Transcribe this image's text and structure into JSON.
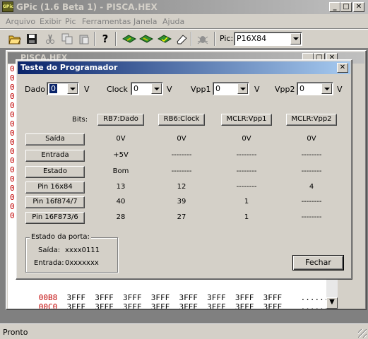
{
  "app": {
    "title": "GPic (1.6 Beta 1) - PISCA.HEX",
    "icon_label": "GPic"
  },
  "menu": [
    "Arquivo",
    "Exibir",
    "Pic",
    "Ferramentas",
    "Janela",
    "Ajuda"
  ],
  "toolbar": {
    "icons": [
      "open-folder-icon",
      "save-icon",
      "cut-icon",
      "copy-icon",
      "paste-icon",
      "help-icon",
      "read-chip-icon",
      "write-chip-icon",
      "verify-chip-icon",
      "erase-icon",
      "bug-icon"
    ],
    "pic_label": "Pic:",
    "pic_value": "P16X84"
  },
  "child": {
    "title": "PISCA.HEX",
    "left_addr_chars": [
      "0",
      "0",
      "0",
      "0",
      "0",
      "0",
      "0",
      "0",
      "0",
      "0",
      "0",
      "0",
      "0",
      "0",
      "0",
      "0",
      "0"
    ],
    "rows": [
      {
        "addr": "00B8",
        "data": "3FFF  3FFF  3FFF  3FFF  3FFF  3FFF  3FFF  3FFF",
        "ascii": "........"
      },
      {
        "addr": "00C0",
        "data": "3FFF  3FFF  3FFF  3FFF  3FFF  3FFF  3FFF  3FFF",
        "ascii": "........"
      }
    ]
  },
  "dialog": {
    "title": "Teste do Programador",
    "dado": {
      "label": "Dado",
      "value": "0",
      "unit": "V"
    },
    "clock": {
      "label": "Clock",
      "value": "0",
      "unit": "V"
    },
    "vpp1": {
      "label": "Vpp1",
      "value": "0",
      "unit": "V"
    },
    "vpp2": {
      "label": "Vpp2",
      "value": "0",
      "unit": "V"
    },
    "bits_label": "Bits:",
    "columns": [
      "RB7:Dado",
      "RB6:Clock",
      "MCLR:Vpp1",
      "MCLR:Vpp2"
    ],
    "rows": [
      {
        "label": "Saída",
        "values": [
          "0V",
          "0V",
          "0V",
          "0V"
        ]
      },
      {
        "label": "Entrada",
        "values": [
          "+5V",
          "--------",
          "--------",
          "--------"
        ]
      },
      {
        "label": "Estado",
        "values": [
          "Bom",
          "--------",
          "--------",
          "--------"
        ]
      },
      {
        "label": "Pin 16x84",
        "values": [
          "13",
          "12",
          "--------",
          "4"
        ]
      },
      {
        "label": "Pin 16f874/7",
        "values": [
          "40",
          "39",
          "1",
          "--------"
        ]
      },
      {
        "label": "Pin 16F873/6",
        "values": [
          "28",
          "27",
          "1",
          "--------"
        ]
      }
    ],
    "port_group": {
      "title": "Estado da porta:",
      "saida_label": "Saída:",
      "saida_value": "xxxx0111",
      "entrada_label": "Entrada:",
      "entrada_value": "0xxxxxxx"
    },
    "close_label": "Fechar"
  },
  "status": {
    "text": "Pronto"
  }
}
